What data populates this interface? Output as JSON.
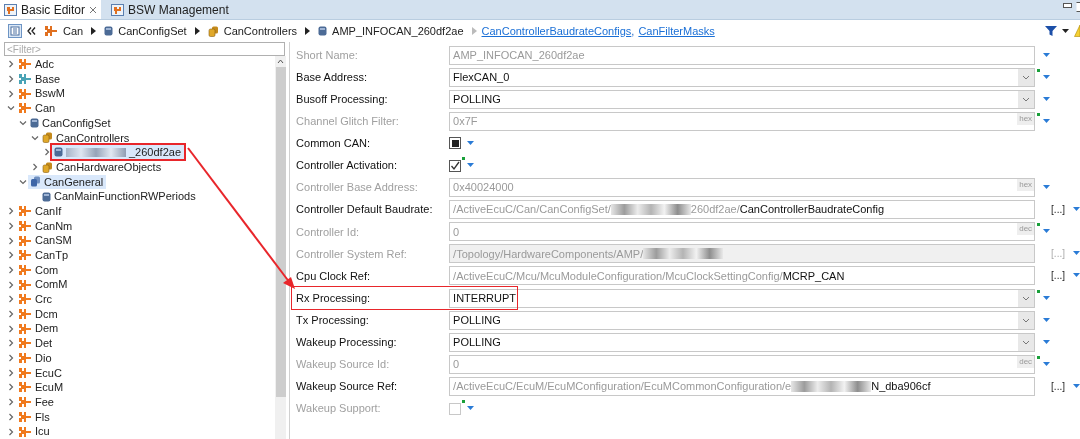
{
  "tabs": [
    {
      "label": "Basic Editor",
      "selected": true,
      "closable": true
    },
    {
      "label": "BSW Management",
      "selected": false,
      "closable": false
    }
  ],
  "breadcrumb": {
    "items": [
      {
        "label": "Can",
        "kind": "module"
      },
      {
        "label": "CanConfigSet",
        "kind": "object"
      },
      {
        "label": "CanControllers",
        "kind": "list"
      },
      {
        "label": "AMP_INFOCAN_260df2ae",
        "kind": "object"
      }
    ],
    "links": [
      "CanControllerBaudrateConfigs",
      "CanFilterMasks"
    ],
    "separator": ","
  },
  "filter": {
    "placeholder": "<Filter>"
  },
  "tree": [
    {
      "label": "Adc",
      "kind": "module",
      "color": "#f07a1e",
      "expanded": false,
      "selected": false
    },
    {
      "label": "Base",
      "kind": "module",
      "color": "#4aa3b5",
      "expanded": false,
      "selected": false
    },
    {
      "label": "BswM",
      "kind": "module",
      "color": "#f07a1e",
      "expanded": false,
      "selected": false
    },
    {
      "label": "Can",
      "kind": "module",
      "color": "#f07a1e",
      "expanded": true,
      "selected": false,
      "children": [
        {
          "label": "CanConfigSet",
          "kind": "object",
          "expanded": true,
          "selected": false,
          "children": [
            {
              "label": "CanControllers",
              "kind": "list",
              "expanded": true,
              "selected": false,
              "children": [
                {
                  "label": "_260df2ae",
                  "kind": "object",
                  "expanded": false,
                  "selected": true,
                  "redacted": true,
                  "annotated": true
                }
              ]
            },
            {
              "label": "CanHardwareObjects",
              "kind": "list",
              "expanded": false,
              "selected": false
            }
          ]
        },
        {
          "label": "CanGeneral",
          "kind": "group",
          "expanded": true,
          "selected": true,
          "children": [
            {
              "label": "CanMainFunctionRWPeriods",
              "kind": "object",
              "leaf": true,
              "selected": false
            }
          ]
        }
      ]
    },
    {
      "label": "CanIf",
      "kind": "module",
      "color": "#f07a1e",
      "expanded": false,
      "selected": false
    },
    {
      "label": "CanNm",
      "kind": "module",
      "color": "#f07a1e",
      "expanded": false,
      "selected": false
    },
    {
      "label": "CanSM",
      "kind": "module",
      "color": "#f07a1e",
      "expanded": false,
      "selected": false
    },
    {
      "label": "CanTp",
      "kind": "module",
      "color": "#f07a1e",
      "expanded": false,
      "selected": false
    },
    {
      "label": "Com",
      "kind": "module",
      "color": "#f07a1e",
      "expanded": false,
      "selected": false
    },
    {
      "label": "ComM",
      "kind": "module",
      "color": "#f07a1e",
      "expanded": false,
      "selected": false
    },
    {
      "label": "Crc",
      "kind": "module",
      "color": "#f07a1e",
      "expanded": false,
      "selected": false
    },
    {
      "label": "Dcm",
      "kind": "module",
      "color": "#f07a1e",
      "expanded": false,
      "selected": false
    },
    {
      "label": "Dem",
      "kind": "module",
      "color": "#f07a1e",
      "expanded": false,
      "selected": false
    },
    {
      "label": "Det",
      "kind": "module",
      "color": "#f07a1e",
      "expanded": false,
      "selected": false
    },
    {
      "label": "Dio",
      "kind": "module",
      "color": "#f07a1e",
      "expanded": false,
      "selected": false
    },
    {
      "label": "EcuC",
      "kind": "module",
      "color": "#f07a1e",
      "expanded": false,
      "selected": false
    },
    {
      "label": "EcuM",
      "kind": "module",
      "color": "#f07a1e",
      "expanded": false,
      "selected": false
    },
    {
      "label": "Fee",
      "kind": "module",
      "color": "#f07a1e",
      "expanded": false,
      "selected": false
    },
    {
      "label": "Fls",
      "kind": "module",
      "color": "#f07a1e",
      "expanded": false,
      "selected": false
    },
    {
      "label": "Icu",
      "kind": "module",
      "color": "#f07a1e",
      "expanded": false,
      "selected": false
    }
  ],
  "form": [
    {
      "label": "Short Name:",
      "kind": "text",
      "enabled": false,
      "modified": false,
      "highlighted": false,
      "value": "AMP_INFOCAN_260df2ae"
    },
    {
      "label": "Base Address:",
      "kind": "combo",
      "enabled": true,
      "modified": true,
      "highlighted": false,
      "value": "FlexCAN_0"
    },
    {
      "label": "Busoff Processing:",
      "kind": "combo",
      "enabled": true,
      "modified": false,
      "highlighted": false,
      "value": "POLLING"
    },
    {
      "label": "Channel Glitch Filter:",
      "kind": "text",
      "enabled": false,
      "modified": true,
      "highlighted": false,
      "value": "0x7F",
      "unit": "hex"
    },
    {
      "label": "Common CAN:",
      "kind": "checkbox",
      "enabled": true,
      "modified": false,
      "highlighted": false,
      "checked": false,
      "mixed": true
    },
    {
      "label": "Controller Activation:",
      "kind": "checkbox",
      "enabled": true,
      "modified": true,
      "highlighted": false,
      "checked": true,
      "mixed": false
    },
    {
      "label": "Controller Base Address:",
      "kind": "text",
      "enabled": false,
      "modified": false,
      "highlighted": false,
      "value": "0x40024000",
      "unit": "hex"
    },
    {
      "label": "Controller Default Baudrate:",
      "kind": "ref",
      "enabled": true,
      "modified": false,
      "highlighted": false,
      "browse": "[...]",
      "segments": [
        {
          "kind": "dim",
          "text": "/ActiveEcuC/Can/CanConfigSet/"
        },
        {
          "kind": "redacted"
        },
        {
          "kind": "dim",
          "text": "260df2ae/"
        },
        {
          "kind": "strong",
          "text": "CanControllerBaudrateConfig"
        }
      ]
    },
    {
      "label": "Controller Id:",
      "kind": "text",
      "enabled": false,
      "modified": true,
      "highlighted": false,
      "value": "0",
      "unit": "dec"
    },
    {
      "label": "Controller System Ref:",
      "kind": "ref",
      "enabled": false,
      "modified": false,
      "highlighted": false,
      "browse": "[...]",
      "segments": [
        {
          "kind": "dim",
          "text": "/Topology/HardwareComponents/AMP/"
        },
        {
          "kind": "redacted"
        }
      ]
    },
    {
      "label": "Cpu Clock Ref:",
      "kind": "ref",
      "enabled": true,
      "modified": false,
      "highlighted": false,
      "browse": "[...]",
      "segments": [
        {
          "kind": "dim",
          "text": "/ActiveEcuC/Mcu/McuModuleConfiguration/McuClockSettingConfig/"
        },
        {
          "kind": "strong",
          "text": "MCRP_CAN"
        }
      ]
    },
    {
      "label": "Rx Processing:",
      "kind": "combo",
      "enabled": true,
      "modified": true,
      "highlighted": true,
      "value": "INTERRUPT"
    },
    {
      "label": "Tx Processing:",
      "kind": "combo",
      "enabled": true,
      "modified": false,
      "highlighted": false,
      "value": "POLLING"
    },
    {
      "label": "Wakeup Processing:",
      "kind": "combo",
      "enabled": true,
      "modified": false,
      "highlighted": false,
      "value": "POLLING"
    },
    {
      "label": "Wakeup Source Id:",
      "kind": "text",
      "enabled": false,
      "modified": true,
      "highlighted": false,
      "value": "0",
      "unit": "dec"
    },
    {
      "label": "Wakeup Source Ref:",
      "kind": "ref",
      "enabled": true,
      "modified": false,
      "highlighted": false,
      "browse": "[...]",
      "segments": [
        {
          "kind": "dim",
          "text": "/ActiveEcuC/EcuM/EcuMConfiguration/EcuMCommonConfiguration/e"
        },
        {
          "kind": "redacted"
        },
        {
          "kind": "strong",
          "text": "N_dba906cf"
        }
      ]
    },
    {
      "label": "Wakeup Support:",
      "kind": "checkbox",
      "enabled": false,
      "modified": true,
      "highlighted": false,
      "checked": false,
      "mixed": false
    }
  ]
}
